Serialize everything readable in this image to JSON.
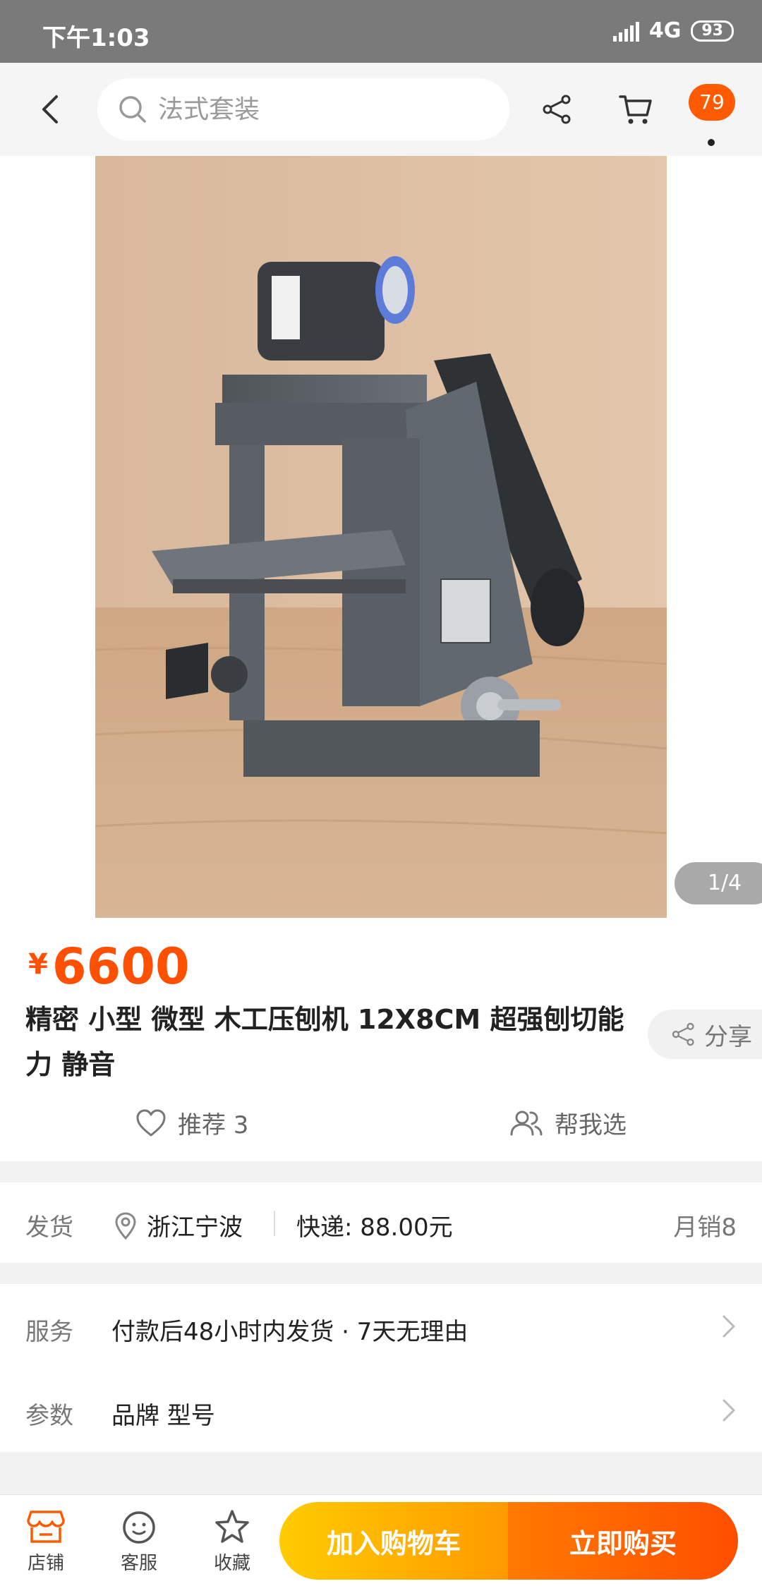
{
  "status_bar": {
    "time": "下午1:03",
    "network": "4G",
    "battery": "93"
  },
  "header": {
    "search_placeholder": "法式套装",
    "message_badge": "79"
  },
  "gallery": {
    "counter": "1/4"
  },
  "product": {
    "currency": "¥",
    "price": "6600",
    "title": "精密 小型 微型 木工压刨机  12X8CM 超强刨切能力 静音",
    "share_label": "分享",
    "recommend_label": "推荐 3",
    "help_choose_label": "帮我选"
  },
  "shipping": {
    "label": "发货",
    "location": "浙江宁波",
    "express": "快递: 88.00元",
    "monthly_sales": "月销8"
  },
  "service": {
    "label": "服务",
    "value": "付款后48小时内发货 · 7天无理由"
  },
  "params": {
    "label": "参数",
    "value": "品牌 型号"
  },
  "bottom_bar": {
    "store": "店铺",
    "customer_service": "客服",
    "favorite": "收藏",
    "add_to_cart": "加入购物车",
    "buy_now": "立即购买"
  },
  "colors": {
    "accent": "#ff5a00",
    "price": "#ff4f00",
    "cart_button": "#ffb300",
    "buy_button": "#ff6200"
  }
}
